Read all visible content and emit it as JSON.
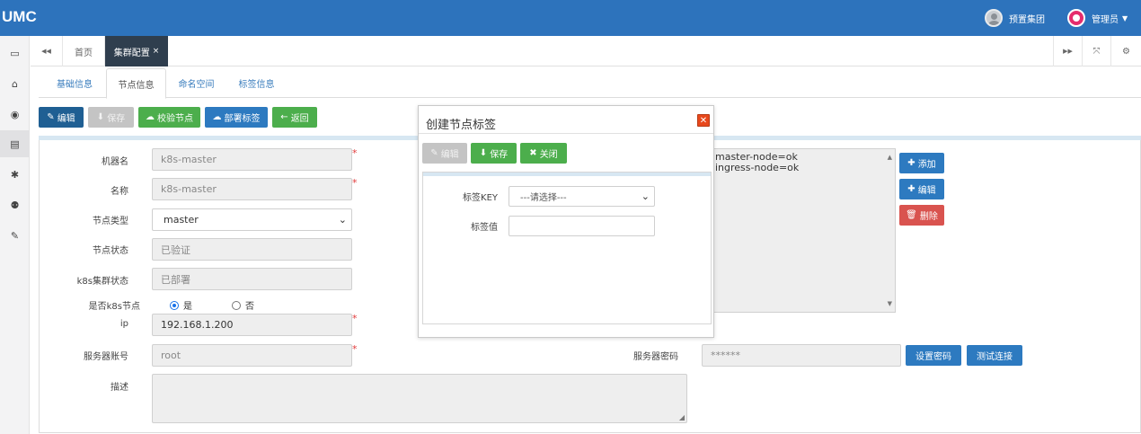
{
  "app": {
    "logo": "UMC"
  },
  "topbar": {
    "group_label": "预置集团",
    "user_label": "管理员"
  },
  "sidebar": {
    "icons": [
      "id-card-icon",
      "bank-icon",
      "eye-icon",
      "server-icon",
      "gear-icon",
      "sitemap-icon",
      "wrench-icon"
    ],
    "glyphs": [
      "▭",
      "⌂",
      "◉",
      "▤",
      "✱",
      "⚉",
      "✎"
    ],
    "active_index": 3
  },
  "tabbar": {
    "prev_glyph": "◀◀",
    "tabs": [
      {
        "label": "首页"
      },
      {
        "label": "集群配置",
        "close": "×",
        "active": true
      }
    ],
    "next_glyph": "▶▶",
    "fullscreen_glyph": "⤧",
    "settings_glyph": "⚙"
  },
  "subtabs": [
    "基础信息",
    "节点信息",
    "命名空间",
    "标签信息"
  ],
  "toolbar": {
    "edit": "编辑",
    "save": "保存",
    "verify": "校验节点",
    "deploy": "部署标签",
    "back": "返回"
  },
  "form": {
    "hostname": {
      "label": "机器名",
      "value": "k8s-master"
    },
    "name": {
      "label": "名称",
      "value": "k8s-master"
    },
    "node_type": {
      "label": "节点类型",
      "value": "master"
    },
    "node_status": {
      "label": "节点状态",
      "value": "已验证"
    },
    "cluster_status": {
      "label": "k8s集群状态",
      "value": "已部署"
    },
    "is_k8s": {
      "label": "是否k8s节点",
      "options": [
        "是",
        "否"
      ],
      "selected": 0
    },
    "ip": {
      "label": "ip",
      "value": "192.168.1.200"
    },
    "account": {
      "label": "服务器账号",
      "value": "root"
    },
    "password": {
      "label": "服务器密码",
      "value": "******"
    },
    "description": {
      "label": "描述",
      "value": ""
    },
    "required_mark": "*"
  },
  "labels_list": {
    "items": [
      "master-node=ok",
      "ingress-node=ok"
    ],
    "add": "添加",
    "edit": "编辑",
    "delete": "删除"
  },
  "password_actions": {
    "set_password": "设置密码",
    "test_connection": "测试连接"
  },
  "modal": {
    "title": "创建节点标签",
    "close_glyph": "✕",
    "edit": "编辑",
    "save": "保存",
    "close": "关闭",
    "key_label": "标签KEY",
    "key_placeholder": "---请选择---",
    "value_label": "标签值",
    "value_value": ""
  },
  "colors": {
    "topbar": "#2d73bc",
    "active_tab": "#2f3e4e",
    "navy_button": "#1f5f93",
    "blue_button": "#2d7ac0",
    "green_button": "#4cae4c",
    "red_button": "#d9534f",
    "modal_close": "#e8481c"
  }
}
